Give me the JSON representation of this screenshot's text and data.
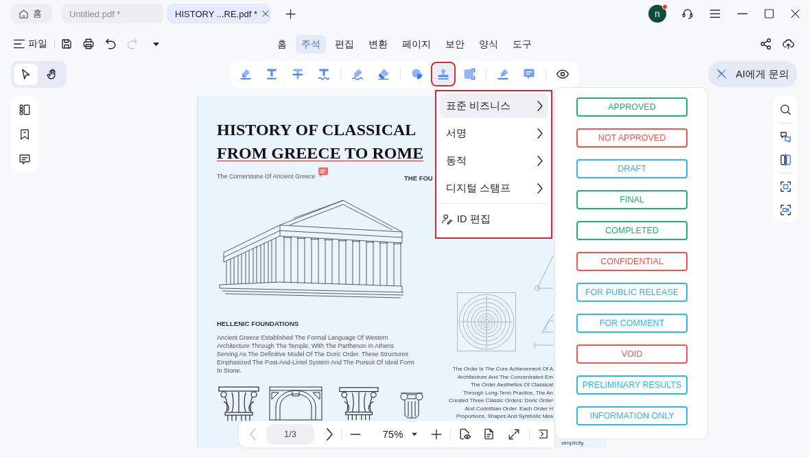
{
  "tabs": [
    {
      "kind": "home",
      "label": "홈",
      "selected": false
    },
    {
      "kind": "document",
      "label": "Untitled.pdf *",
      "selected": false
    },
    {
      "kind": "document",
      "label": "HISTORY ...RE.pdf *",
      "selected": true
    }
  ],
  "account": {
    "initial": "n",
    "notification": true
  },
  "menu_bar": {
    "file_label": "파일",
    "history": [
      {
        "kind": "undo",
        "disabled": false
      },
      {
        "kind": "redo",
        "disabled": true
      }
    ],
    "tabs": [
      {
        "label": "홈",
        "selected": false
      },
      {
        "label": "주석",
        "selected": true
      },
      {
        "label": "편집",
        "selected": false
      },
      {
        "label": "변환",
        "selected": false
      },
      {
        "label": "페이지",
        "selected": false
      },
      {
        "label": "보안",
        "selected": false
      },
      {
        "label": "양식",
        "selected": false
      },
      {
        "label": "도구",
        "selected": false
      }
    ]
  },
  "view_tools": [
    {
      "kind": "select",
      "selected": true
    },
    {
      "kind": "hand",
      "selected": false
    }
  ],
  "annotation_groups": [
    [
      {
        "kind": "highlight",
        "selected": false
      },
      {
        "kind": "text",
        "selected": false
      },
      {
        "kind": "strikeout",
        "selected": false
      },
      {
        "kind": "squiggly",
        "selected": false
      }
    ],
    [
      {
        "kind": "pencil",
        "selected": false
      },
      {
        "kind": "eraser",
        "selected": false
      }
    ],
    [
      {
        "kind": "shape",
        "selected": false
      },
      {
        "kind": "stamp",
        "selected": true
      },
      {
        "kind": "area",
        "selected": false
      }
    ],
    [
      {
        "kind": "signature",
        "selected": false
      },
      {
        "kind": "comment",
        "selected": false
      }
    ],
    [
      {
        "kind": "preview",
        "selected": false
      }
    ]
  ],
  "ai_button": "AI에게 문의",
  "document": {
    "title_lines": [
      {
        "text": "HISTORY OF CLASSICAL",
        "underlined": false
      },
      {
        "text": "FROM GREECE TO ROME",
        "underlined": true
      }
    ],
    "subtitle": "The Cornerstone Of Ancient Greece",
    "right_heading": "THE FOU",
    "section_heading": "HELLENIC FOUNDATIONS",
    "section_body": "Ancient Greece Established The Formal Language Of Western Architecture Through The Temple, With The Parthenon In Athens Serving As The Definitive Model Of The Doric Order. These Structures Emphasized The Post-And-Lintel System And The Pursuit Of Ideal Form In Stone.",
    "right_lines": [
      "The Order Is The Core Achievement Of A",
      "Architecture And The Concentrated Em",
      "The Order Aesthetics Of Classical",
      "Through Long-Term Practice, The An",
      "Created Three Classic Orders: Doric Order",
      "And Corinthian Order. Each Order H",
      "Proportions, Shapes And Symbolic Mea"
    ],
    "closing_fragment": "simplicity."
  },
  "stamp_menu": {
    "items": [
      {
        "kind": "submenu",
        "label": "표준 비즈니스",
        "selected": true
      },
      {
        "kind": "submenu",
        "label": "서명",
        "selected": false
      },
      {
        "kind": "submenu",
        "label": "동적",
        "selected": false
      },
      {
        "kind": "submenu",
        "label": "디지털 스탬프",
        "selected": false
      },
      {
        "kind": "action",
        "label": "ID 편집",
        "selected": false
      }
    ]
  },
  "stamps": [
    {
      "label": "APPROVED",
      "color": "#1fb36b"
    },
    {
      "label": "NOT APPROVED",
      "color": "#f0564b"
    },
    {
      "label": "DRAFT",
      "color": "#2fb6f0"
    },
    {
      "label": "FINAL",
      "color": "#1fb36b"
    },
    {
      "label": "COMPLETED",
      "color": "#1fb36b"
    },
    {
      "label": "CONFIDENTIAL",
      "color": "#f0564b"
    },
    {
      "label": "FOR PUBLIC RELEASE",
      "color": "#2fb6f0"
    },
    {
      "label": "FOR COMMENT",
      "color": "#2fb6f0"
    },
    {
      "label": "VOID",
      "color": "#f0564b"
    },
    {
      "label": "PRELIMINARY RESULTS",
      "color": "#2fb6f0"
    },
    {
      "label": "INFORMATION ONLY",
      "color": "#2fb6f0"
    }
  ],
  "bottom_toolbar": {
    "prev_page": {
      "disabled": true
    },
    "page": "1/3",
    "next_page": {
      "disabled": false
    },
    "zoom": "75%"
  }
}
